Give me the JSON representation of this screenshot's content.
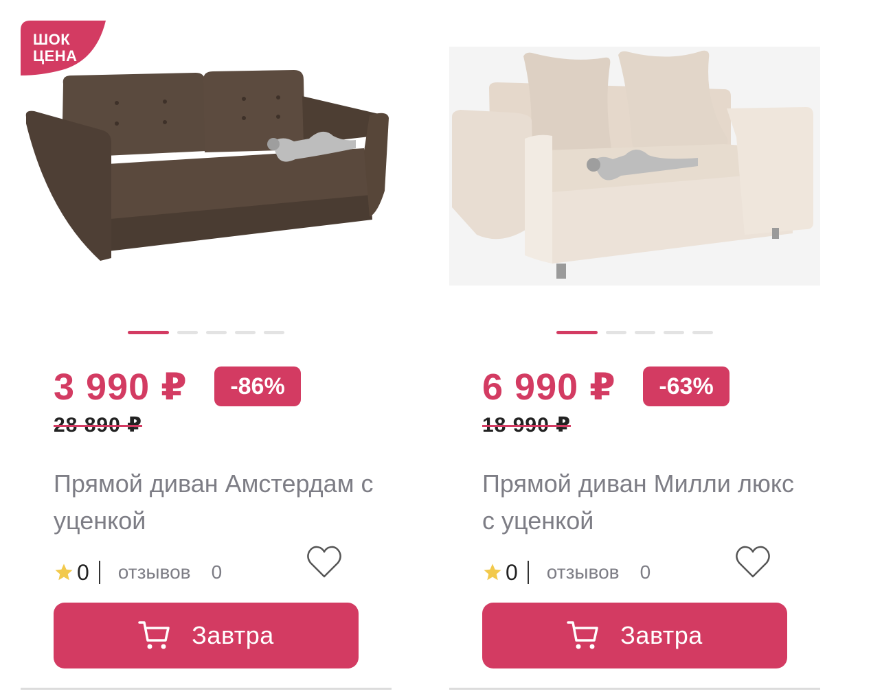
{
  "products": [
    {
      "badge": "ШОК ЦЕНА",
      "badge_line1": "ШОК",
      "badge_line2": "ЦЕНА",
      "price": "3 990 ₽",
      "discount": "-86%",
      "old_price": "28 890 ₽",
      "title": "Прямой диван Амстердам с уценкой",
      "rating": "0",
      "reviews_label": "отзывов",
      "reviews_count": "0",
      "button_label": "Завтра",
      "sofa_color": "#5a4a3e",
      "image_index": 1,
      "image_count": 5
    },
    {
      "price": "6 990 ₽",
      "discount": "-63%",
      "old_price": "18 990 ₽",
      "title": "Прямой диван Милли люкс с уценкой",
      "rating": "0",
      "reviews_label": "отзывов",
      "reviews_count": "0",
      "button_label": "Завтра",
      "sofa_color": "#e9ddd1",
      "image_index": 1,
      "image_count": 5
    }
  ],
  "icons": {
    "cart": "shopping-cart-icon",
    "star": "star-icon",
    "heart": "heart-icon"
  },
  "colors": {
    "accent": "#d33b62",
    "muted_text": "#7d7d85",
    "star": "#f2c94c"
  }
}
